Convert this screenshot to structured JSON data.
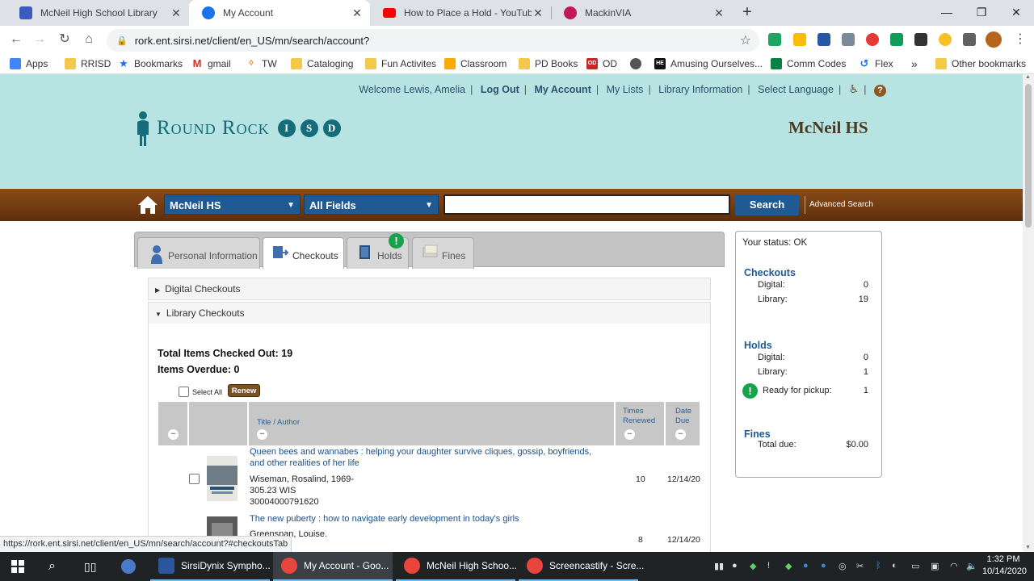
{
  "browser": {
    "tabs": [
      {
        "title": "McNeil High School Library",
        "icon": "library-favicon",
        "color": "#3b5bbf"
      },
      {
        "title": "My Account",
        "icon": "sirsi-favicon",
        "color": "#1a73e8"
      },
      {
        "title": "How to Place a Hold - YouTube",
        "icon": "youtube-favicon",
        "color": "#ff0000"
      },
      {
        "title": "MackinVIA",
        "icon": "mackinvia-favicon",
        "color": "#c2185b"
      }
    ],
    "url": "rork.ent.sirsi.net/client/en_US/mn/search/account?",
    "bookmarks": [
      {
        "label": "Apps",
        "icon": "apps-grid-icon"
      },
      {
        "label": "RRISD",
        "icon": "folder-icon"
      },
      {
        "label": "Bookmarks",
        "icon": "star-icon"
      },
      {
        "label": "gmail",
        "icon": "gmail-icon"
      },
      {
        "label": "TW",
        "icon": "tw-icon"
      },
      {
        "label": "Cataloging",
        "icon": "folder-icon"
      },
      {
        "label": "Fun Activites",
        "icon": "folder-icon"
      },
      {
        "label": "Classroom",
        "icon": "classroom-icon"
      },
      {
        "label": "PD Books",
        "icon": "folder-icon"
      },
      {
        "label": "OD",
        "icon": "od-icon"
      },
      {
        "label": "",
        "icon": "globe-icon"
      },
      {
        "label": "Amusing Ourselves...",
        "icon": "he-icon"
      },
      {
        "label": "Comm Codes",
        "icon": "comm-codes-icon"
      },
      {
        "label": "Flex",
        "icon": "flex-icon"
      },
      {
        "label": "Other bookmarks",
        "icon": "folder-icon"
      }
    ],
    "more_bookmarks": "»",
    "status_url": "https://rork.ent.sirsi.net/client/en_US/mn/search/account?#checkoutsTab"
  },
  "header": {
    "welcome": "Welcome Lewis, Amelia",
    "links": [
      "Log Out",
      "My Account",
      "My Lists",
      "Library Information",
      "Select Language"
    ],
    "logo_text": "Round Rock",
    "logo_isd": [
      "I",
      "S",
      "D"
    ],
    "school": "McNeil HS"
  },
  "search": {
    "library_select": "McNeil HS",
    "field_select": "All Fields",
    "query": "",
    "search_label": "Search",
    "advanced_label": "Advanced Search"
  },
  "account_tabs": [
    {
      "label": "Personal Information",
      "icon": "person-icon"
    },
    {
      "label": "Checkouts",
      "icon": "checkout-book-icon"
    },
    {
      "label": "Holds",
      "icon": "book-icon"
    },
    {
      "label": "Fines",
      "icon": "money-icon"
    }
  ],
  "holds_badge": "!",
  "sections": {
    "digital": "Digital Checkouts",
    "library": "Library Checkouts"
  },
  "checkouts": {
    "total_label": "Total Items Checked Out: 19",
    "overdue_label": "Items Overdue: 0",
    "select_all": "Select All",
    "renew": "Renew",
    "columns": {
      "title_author": "Title / Author",
      "times_renewed": "Times Renewed",
      "date_due": "Date Due"
    },
    "items": [
      {
        "title": "Queen bees and wannabes : helping your daughter survive cliques, gossip, boyfriends, and other realities of her life",
        "author": "Wiseman, Rosalind, 1969-",
        "call_number": "305.23 WIS",
        "barcode": "30004000791620",
        "times_renewed": "10",
        "date_due": "12/14/20"
      },
      {
        "title": "The new puberty : how to navigate early development in today's girls",
        "author": "Greenspan, Louise.",
        "times_renewed": "8",
        "date_due": "12/14/20"
      }
    ]
  },
  "status": {
    "status_line": "Your status: OK",
    "checkouts_label": "Checkouts",
    "checkouts": [
      {
        "label": "Digital:",
        "value": "0"
      },
      {
        "label": "Library:",
        "value": "19"
      }
    ],
    "holds_label": "Holds",
    "holds": [
      {
        "label": "Digital:",
        "value": "0"
      },
      {
        "label": "Library:",
        "value": "1"
      }
    ],
    "ready_label": "Ready for pickup:",
    "ready_value": "1",
    "fines_label": "Fines",
    "total_due_label": "Total due:",
    "total_due_value": "$0.00"
  },
  "taskbar": {
    "apps": [
      {
        "label": "SirsiDynix Sympho...",
        "icon": "sirsi-app-icon",
        "color": "#2b579a"
      },
      {
        "label": "My Account - Goo...",
        "icon": "chrome-icon",
        "color": "#e8453c"
      },
      {
        "label": "McNeil High Schoo...",
        "icon": "chrome-icon",
        "color": "#e8453c"
      },
      {
        "label": "Screencastify - Scre...",
        "icon": "chrome-icon",
        "color": "#e8453c"
      }
    ],
    "time": "1:32 PM",
    "date": "10/14/2020"
  }
}
